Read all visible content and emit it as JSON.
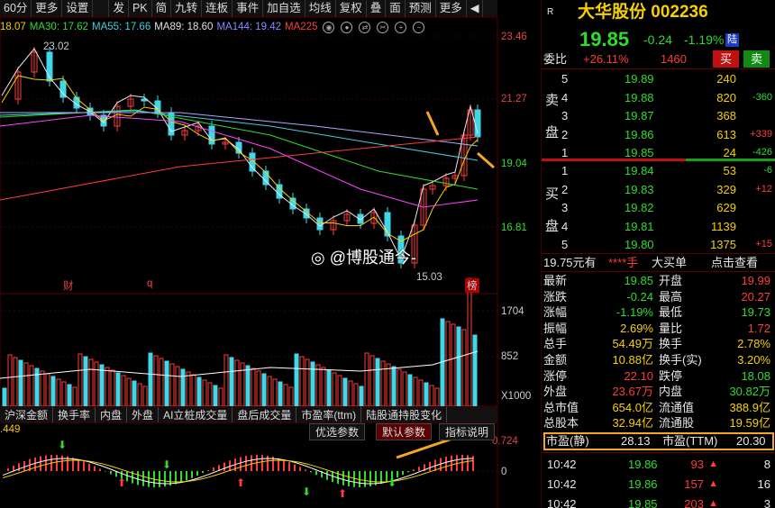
{
  "toolbar": {
    "items": [
      "60分",
      "更多",
      "设置",
      "发",
      "PK",
      "简",
      "九转",
      "连板",
      "事件",
      "加自选",
      "均线",
      "复权",
      "叠",
      "面",
      "预测",
      "更多"
    ],
    "collapse": "◀"
  },
  "ma": {
    "ma1": "18.07",
    "ma30": "MA30: 17.62",
    "ma55": "MA55: 17.66",
    "ma89": "MA89: 18.60",
    "ma144": "MA144: 19.42",
    "ma225": "MA225"
  },
  "price_axis": [
    "23.46",
    "21.27",
    "19.04",
    "16.81"
  ],
  "vol_axis": [
    "1704",
    "852",
    "X1000"
  ],
  "macd_axis": [
    "0.724",
    "0"
  ],
  "macd_left": ".449",
  "annotations": {
    "high": "23.02",
    "low": "15.03",
    "cai": "财",
    "q": "q",
    "bang": "榜"
  },
  "watermark": "@博股通今-",
  "tabs": [
    "沪深金额",
    "换手率",
    "内盘",
    "外盘",
    "AI立桩成交量",
    "盘后成交量",
    "市盈率(ttm)",
    "陆股通持股变化"
  ],
  "subbuttons": [
    "优选参数",
    "默认参数",
    "指标说明"
  ],
  "stock": {
    "r": "R",
    "name": "大华股份 002236",
    "price": "19.85",
    "change": "-0.24",
    "pct": "-1.19%",
    "tag": "陆",
    "weibi_label": "委比",
    "weibi": "+26.11%",
    "weicha": "1460",
    "buy": "买",
    "sell": "卖"
  },
  "asks": [
    {
      "lvl": "5",
      "price": "19.89",
      "vol": "240",
      "chg": ""
    },
    {
      "lvl": "4",
      "price": "19.88",
      "vol": "820",
      "chg": "-360"
    },
    {
      "lvl": "3",
      "price": "19.87",
      "vol": "368",
      "chg": ""
    },
    {
      "lvl": "2",
      "price": "19.86",
      "vol": "613",
      "chg": "+339"
    },
    {
      "lvl": "1",
      "price": "19.85",
      "vol": "24",
      "chg": "-426"
    }
  ],
  "ask_side": [
    "卖",
    "盘"
  ],
  "bids": [
    {
      "lvl": "1",
      "price": "19.84",
      "vol": "53",
      "chg": "-6"
    },
    {
      "lvl": "2",
      "price": "19.83",
      "vol": "329",
      "chg": "+12"
    },
    {
      "lvl": "3",
      "price": "19.82",
      "vol": "629",
      "chg": ""
    },
    {
      "lvl": "4",
      "price": "19.81",
      "vol": "1139",
      "chg": ""
    },
    {
      "lvl": "5",
      "price": "19.80",
      "vol": "1375",
      "chg": "+15"
    }
  ],
  "bid_side": [
    "买",
    "盘"
  ],
  "bar": {
    "price": "19.75元有",
    "stars": "****手",
    "big": "大买单",
    "view": "点击查看"
  },
  "stats": [
    [
      "最新",
      "19.85",
      "开盘",
      "19.99"
    ],
    [
      "涨跌",
      "-0.24",
      "最高",
      "20.27"
    ],
    [
      "涨幅",
      "-1.19%",
      "最低",
      "19.73"
    ],
    [
      "振幅",
      "2.69%",
      "量比",
      "1.72"
    ],
    [
      "总手",
      "54.49万",
      "换手",
      "2.78%"
    ],
    [
      "金额",
      "10.88亿",
      "换手(实)",
      "3.20%"
    ],
    [
      "涨停",
      "22.10",
      "跌停",
      "18.08"
    ],
    [
      "外盘",
      "23.67万",
      "内盘",
      "30.82万"
    ],
    [
      "总市值",
      "654.0亿",
      "流通值",
      "388.9亿"
    ],
    [
      "总股本",
      "32.94亿",
      "流通股",
      "19.59亿"
    ]
  ],
  "pe": {
    "static_label": "市盈(静)",
    "static": "28.13",
    "ttm_label": "市盈(TTM)",
    "ttm": "20.30"
  },
  "ticks": [
    {
      "t": "10:42",
      "p": "19.86",
      "v": "93",
      "n": "8"
    },
    {
      "t": "10:42",
      "p": "19.86",
      "v": "157",
      "n": "16"
    },
    {
      "t": "10:42",
      "p": "19.85",
      "v": "203",
      "n": "3"
    }
  ],
  "colors": {
    "up": "#ff3b3b",
    "down": "#40d8e8",
    "accent": "#f5a623",
    "bg": "#000000"
  }
}
